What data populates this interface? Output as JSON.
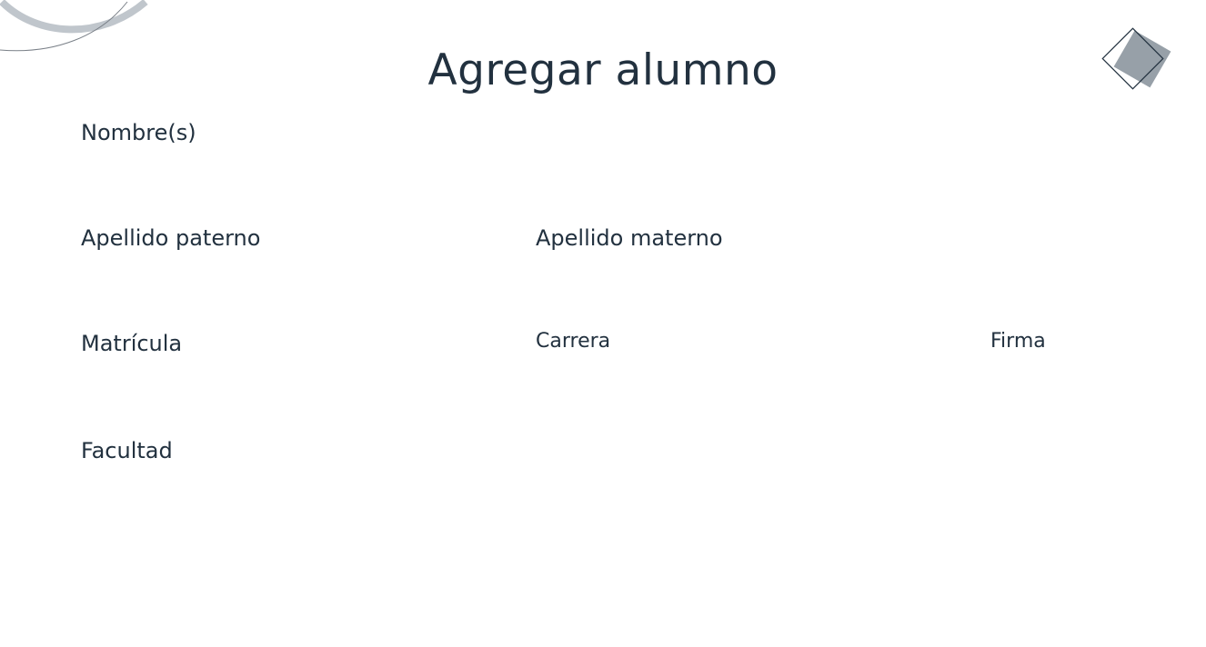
{
  "form": {
    "title": "Agregar alumno",
    "fields": {
      "nombre": "Nombre(s)",
      "apellido_paterno": "Apellido paterno",
      "apellido_materno": "Apellido materno",
      "matricula": "Matrícula",
      "carrera": "Carrera",
      "firma": "Firma",
      "facultad": "Facultad"
    }
  },
  "colors": {
    "text": "#22313f",
    "arc_light": "#c0c6cc",
    "arc_dark": "#7a8088",
    "diamond_fill": "#97a0a8",
    "diamond_outline": "#22313f"
  }
}
